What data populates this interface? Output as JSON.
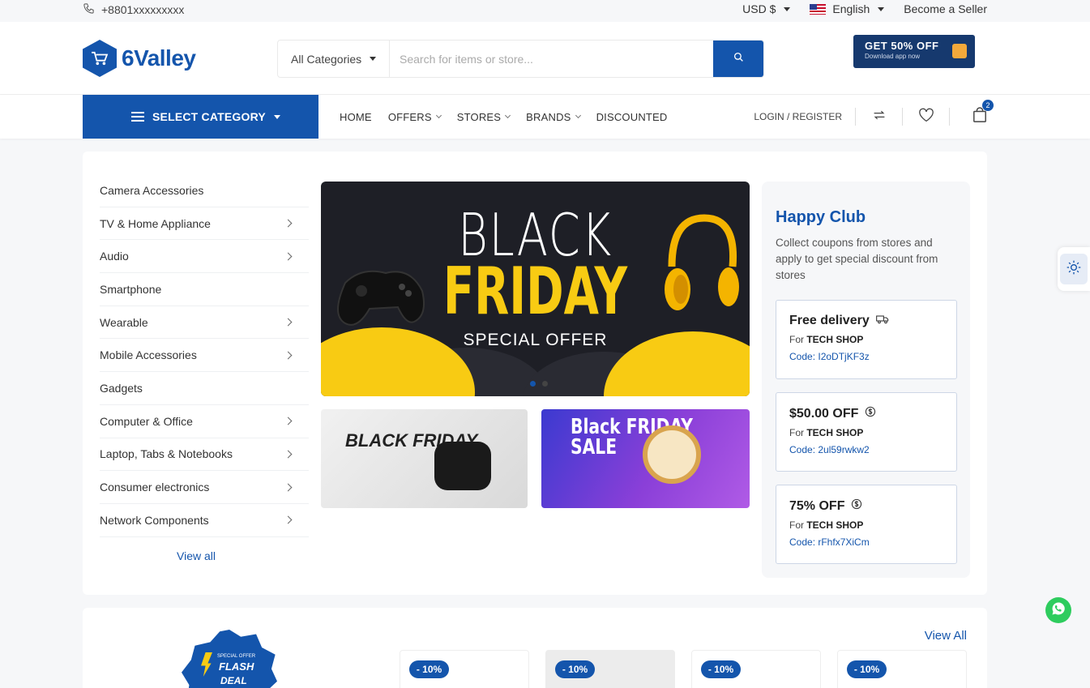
{
  "topbar": {
    "phone": "+8801xxxxxxxxx",
    "currency": "USD $",
    "language": "English",
    "become_seller": "Become a Seller"
  },
  "header": {
    "logo_text": "6Valley",
    "search_category": "All Categories",
    "search_placeholder": "Search for items or store...",
    "promo_title": "GET 50% OFF",
    "promo_subtitle": "Download app now"
  },
  "nav": {
    "select_category": "SELECT CATEGORY",
    "items": [
      "HOME",
      "OFFERS",
      "STORES",
      "BRANDS",
      "DISCOUNTED"
    ],
    "login": "LOGIN / REGISTER",
    "cart_count": "2"
  },
  "categories": {
    "items": [
      {
        "label": "Camera Accessories",
        "has_sub": false
      },
      {
        "label": "TV & Home Appliance",
        "has_sub": true
      },
      {
        "label": "Audio",
        "has_sub": true
      },
      {
        "label": "Smartphone",
        "has_sub": false
      },
      {
        "label": "Wearable",
        "has_sub": true
      },
      {
        "label": "Mobile Accessories",
        "has_sub": true
      },
      {
        "label": "Gadgets",
        "has_sub": false
      },
      {
        "label": "Computer & Office",
        "has_sub": true
      },
      {
        "label": "Laptop, Tabs & Notebooks",
        "has_sub": true
      },
      {
        "label": "Consumer electronics",
        "has_sub": true
      },
      {
        "label": "Network Components",
        "has_sub": true
      }
    ],
    "view_all": "View all"
  },
  "hero": {
    "line1": "BLACK",
    "line2": "FRIDAY",
    "line3": "SPECIAL OFFER"
  },
  "banners": {
    "b1_text": "BLACK FRIDAY",
    "b2_text": "Black FRIDAY SALE"
  },
  "club": {
    "title": "Happy Club",
    "desc": "Collect coupons from stores and apply to get special discount from stores",
    "coupons": [
      {
        "title": "Free delivery",
        "for_label": "For",
        "store": "TECH SHOP",
        "code": "Code: I2oDTjKF3z"
      },
      {
        "title": "$50.00 OFF",
        "for_label": "For",
        "store": "TECH SHOP",
        "code": "Code: 2ul59rwkw2"
      },
      {
        "title": "75% OFF",
        "for_label": "For",
        "store": "TECH SHOP",
        "code": "Code: rFhfx7XiCm"
      }
    ]
  },
  "flash": {
    "badge_line1": "SPECIAL OFFER",
    "badge_line2": "FLASH",
    "badge_line3": "DEAL",
    "view_all": "View All",
    "discounts": [
      "- 10%",
      "- 10%",
      "- 10%",
      "- 10%"
    ]
  },
  "colors": {
    "primary": "#1455ac",
    "accent": "#f8cb13"
  }
}
